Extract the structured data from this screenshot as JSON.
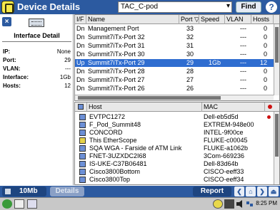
{
  "titlebar": {
    "title": "Device Details",
    "search_value": "TAC_C-pod",
    "find_label": "Find",
    "help_label": "?"
  },
  "left_panel": {
    "close_label": "×",
    "title": "Interface Detail",
    "fields": [
      {
        "label": "IP:",
        "value": "None"
      },
      {
        "label": "Port:",
        "value": "29"
      },
      {
        "label": "VLAN:",
        "value": "---"
      },
      {
        "label": "Interface:",
        "value": "1Gb"
      },
      {
        "label": "Hosts:",
        "value": "12"
      }
    ]
  },
  "ports_table": {
    "headers": [
      "I/F",
      "Name",
      "Port",
      "Speed",
      "VLAN",
      "Hosts"
    ],
    "sort_indicator": "▽",
    "selected_row": 4,
    "rows": [
      {
        "if": "Dn",
        "name": "Management Port",
        "port": "33",
        "speed": "",
        "vlan": "---",
        "hosts": "0"
      },
      {
        "if": "Dn",
        "name": "Summit7iTx-Port 32",
        "port": "32",
        "speed": "",
        "vlan": "---",
        "hosts": "0"
      },
      {
        "if": "Dn",
        "name": "Summit7iTx-Port 31",
        "port": "31",
        "speed": "",
        "vlan": "---",
        "hosts": "0"
      },
      {
        "if": "Dn",
        "name": "Summit7iTx-Port 30",
        "port": "30",
        "speed": "",
        "vlan": "---",
        "hosts": "0"
      },
      {
        "if": "Up",
        "name": "Summit7iTx-Port 29",
        "port": "29",
        "speed": "1Gb",
        "vlan": "---",
        "hosts": "12"
      },
      {
        "if": "Dn",
        "name": "Summit7iTx-Port 28",
        "port": "28",
        "speed": "",
        "vlan": "---",
        "hosts": "0"
      },
      {
        "if": "Dn",
        "name": "Summit7iTx-Port 27",
        "port": "27",
        "speed": "",
        "vlan": "---",
        "hosts": "0"
      },
      {
        "if": "Dn",
        "name": "Summit7iTx-Port 26",
        "port": "26",
        "speed": "",
        "vlan": "---",
        "hosts": "0"
      }
    ]
  },
  "hosts_table": {
    "headers": [
      "Host",
      "MAC"
    ],
    "rows": [
      {
        "host": "EVTPC1272",
        "mac": "Dell-eb5d5d",
        "icon": "pc-icon",
        "alert": true
      },
      {
        "host": "F_Pod_Summit48",
        "mac": "EXTREM-948e00",
        "icon": "switch-icon",
        "alert": false
      },
      {
        "host": "CONCORD",
        "mac": "INTEL-9f00ce",
        "icon": "pc-icon",
        "alert": false
      },
      {
        "host": "This EtherScope",
        "mac": "FLUKE-c00045",
        "icon": "etherscope-icon",
        "alert": false
      },
      {
        "host": "SQA WGA - Farside of ATM Link",
        "mac": "FLUKE-a1062b",
        "icon": "pc-icon",
        "alert": false
      },
      {
        "host": "FNET-3UZXDC2I68",
        "mac": "3Com-669236",
        "icon": "pc-icon",
        "alert": false
      },
      {
        "host": "IS-UKE-C37B06481",
        "mac": "Dell-83d64b",
        "icon": "pc-icon",
        "alert": false
      },
      {
        "host": "Cisco3800Bottom",
        "mac": "CISCO-eeff33",
        "icon": "router-icon",
        "alert": false
      },
      {
        "host": "Cisco3800Top",
        "mac": "CISCO-eeff34",
        "icon": "router-icon",
        "alert": false
      }
    ]
  },
  "bottom_bar": {
    "speed_label": "10Mb",
    "details_label": "Details",
    "report_label": "Report"
  },
  "taskbar": {
    "clock": "8:25 PM"
  }
}
